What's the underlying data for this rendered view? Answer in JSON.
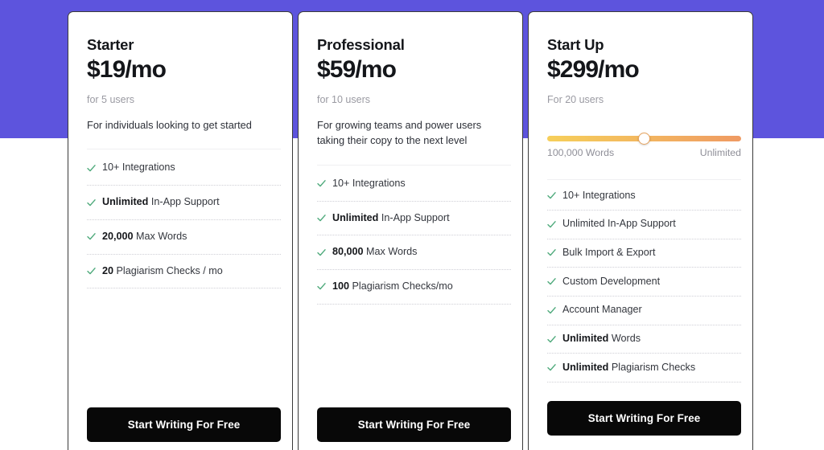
{
  "theme": {
    "band_color": "#5d54dd",
    "card_bg": "#ffffff",
    "cta_bg": "#080808",
    "cta_text_color": "#ffffff",
    "check_color": "#4faa7c",
    "slider_gradient_start": "#f6cf5a",
    "slider_gradient_end": "#ef9a63"
  },
  "plans": [
    {
      "name": "Starter",
      "price": "$19/mo",
      "users": "for 5 users",
      "description": "For individuals looking to get started",
      "features": [
        {
          "strong": "",
          "text": "10+ Integrations"
        },
        {
          "strong": "Unlimited",
          "text": " In-App Support"
        },
        {
          "strong": "20,000",
          "text": " Max Words"
        },
        {
          "strong": "20",
          "text": " Plagiarism Checks / mo"
        }
      ],
      "cta": "Start Writing For Free"
    },
    {
      "name": "Professional",
      "price": "$59/mo",
      "users": "for 10 users",
      "description": "For growing teams and power users taking their copy to the next level",
      "features": [
        {
          "strong": "",
          "text": "10+ Integrations"
        },
        {
          "strong": "Unlimited",
          "text": " In-App Support"
        },
        {
          "strong": "80,000",
          "text": " Max Words"
        },
        {
          "strong": "100",
          "text": " Plagiarism Checks/mo"
        }
      ],
      "cta": "Start Writing For Free"
    },
    {
      "name": "Start Up",
      "price": "$299/mo",
      "users": "For 20 users",
      "description": "",
      "slider": {
        "min_label": "100,000 Words",
        "max_label": "Unlimited",
        "value_percent": 50
      },
      "features": [
        {
          "strong": "",
          "text": "10+ Integrations"
        },
        {
          "strong": "",
          "text": "Unlimited In-App Support"
        },
        {
          "strong": "",
          "text": "Bulk Import & Export"
        },
        {
          "strong": "",
          "text": "Custom Development"
        },
        {
          "strong": "",
          "text": "Account Manager"
        },
        {
          "strong": "Unlimited",
          "text": " Words"
        },
        {
          "strong": "Unlimited",
          "text": " Plagiarism Checks"
        }
      ],
      "cta": "Start Writing For Free"
    }
  ],
  "icons": {
    "check": "check-icon"
  }
}
